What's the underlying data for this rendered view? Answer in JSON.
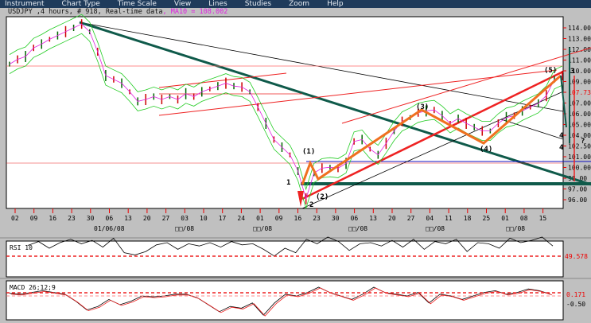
{
  "menu": [
    "Instrument",
    "Chart Type",
    "Time Scale",
    "View",
    "Lines",
    "Studies",
    "Zoom",
    "Help"
  ],
  "title": {
    "main": "USDJPY ,4 hours, # 918, Real-time data",
    "ma": ", MA10 = 108.002"
  },
  "price_axis": {
    "labels": [
      "114.00",
      "113.00",
      "112.00",
      "111.00",
      "110.00",
      "109.00",
      "107.73",
      "107.00",
      "106.00",
      "105.00",
      "104.00",
      "102.50",
      "101.00",
      "100.00",
      "98.00",
      "97.00",
      "96.00"
    ],
    "current": "107.73"
  },
  "date_axis": {
    "days": [
      "02",
      "09",
      "16",
      "23",
      "30",
      "06",
      "13",
      "20",
      "27",
      "03",
      "10",
      "17",
      "24",
      "01",
      "09",
      "16",
      "23",
      "30",
      "06",
      "13",
      "20",
      "27",
      "04",
      "11",
      "18",
      "25",
      "01",
      "08",
      "15"
    ],
    "months": [
      "01/06/08",
      "□□/08",
      "□□/08",
      "□□/08",
      "□□/08",
      "□□/08"
    ]
  },
  "annotations": {
    "w1": "(1)",
    "w2": "(2)",
    "w3": "(3)",
    "w4": "(4)",
    "w5": "(5)",
    "n1": "1",
    "n2": "2",
    "n3": "3",
    "n4a": "4",
    "n4b": "4",
    "q": "?"
  },
  "price_series": [
    110.2,
    110.7,
    111,
    111.9,
    112.3,
    112.8,
    113.2,
    113.6,
    114,
    114.4,
    113.6,
    111.5,
    109,
    108.6,
    108.2,
    107.3,
    106.3,
    106.5,
    106.8,
    106.5,
    106.8,
    106.5,
    107.1,
    106.8,
    107.3,
    107.6,
    107.9,
    108.2,
    107.9,
    107.8,
    107.3,
    105.7,
    104,
    102.3,
    101.5,
    100.7,
    99,
    96.1,
    98.8,
    99.3,
    99.4,
    99.3,
    99.8,
    102.1,
    102.3,
    101.3,
    100.7,
    101.9,
    103.2,
    104.2,
    104.6,
    105.1,
    105.3,
    105.4,
    104.8,
    104,
    104.5,
    104,
    103.6,
    103.2,
    103.2,
    104,
    104.6,
    104.8,
    105.3,
    105.7,
    106.1,
    106.9,
    108.6,
    109
  ],
  "rsi": {
    "label": "RSI 10",
    "value": "49.578",
    "series": [
      55,
      62,
      50,
      60,
      66,
      58,
      64,
      52,
      68,
      42,
      38,
      44,
      56,
      60,
      48,
      58,
      54,
      60,
      52,
      62,
      56,
      58,
      48,
      36,
      50,
      42,
      66,
      58,
      70,
      62,
      46,
      58,
      60,
      54,
      64,
      52,
      66,
      48,
      62,
      58,
      66,
      44,
      60,
      58,
      50,
      68,
      60,
      64,
      70,
      54
    ]
  },
  "macd": {
    "label": "MACD 26;12;9",
    "value": "0.171",
    "level": "-0.50",
    "series": [
      0.15,
      0.1,
      0.2,
      0.3,
      0.2,
      0.1,
      -0.3,
      -0.8,
      -0.6,
      -0.2,
      -0.5,
      -0.3,
      0,
      -0.05,
      0,
      0.1,
      0.1,
      -0.1,
      -0.5,
      -0.9,
      -0.6,
      -0.7,
      -0.4,
      -1.1,
      -0.4,
      0.1,
      0,
      0.2,
      0.5,
      0.2,
      0,
      -0.2,
      0.1,
      0.5,
      0.2,
      0.1,
      0,
      0.2,
      -0.4,
      0.1,
      0,
      -0.2,
      0,
      0.2,
      0.3,
      0.1,
      0.2,
      0.4,
      0.3,
      0.1
    ]
  },
  "colors": {
    "menubar": "#1f3b5b",
    "ma": "#e020e0",
    "trend": "#0f5a4a",
    "wave": "#f07020",
    "channel": "#ff2020"
  }
}
